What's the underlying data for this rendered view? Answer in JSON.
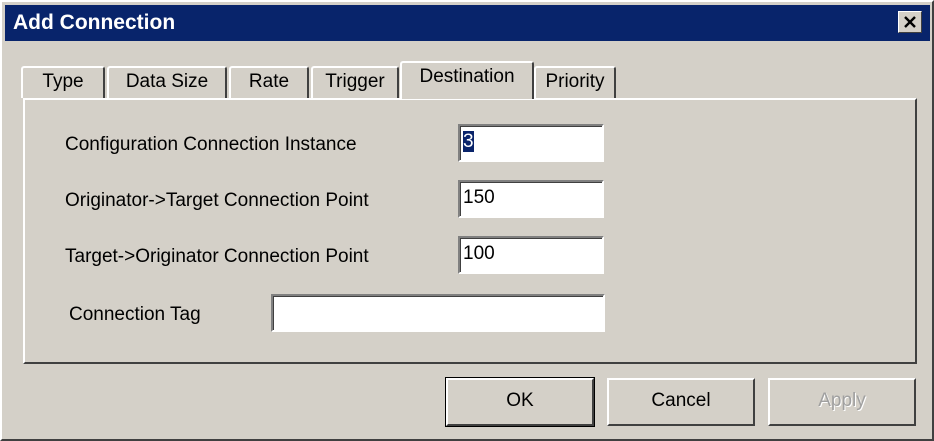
{
  "window": {
    "title": "Add Connection"
  },
  "tabs": [
    {
      "label": "Type",
      "active": false
    },
    {
      "label": "Data Size",
      "active": false
    },
    {
      "label": "Rate",
      "active": false
    },
    {
      "label": "Trigger",
      "active": false
    },
    {
      "label": "Destination",
      "active": true
    },
    {
      "label": "Priority",
      "active": false
    }
  ],
  "destination": {
    "config_instance": {
      "label": "Configuration Connection Instance",
      "value": "3"
    },
    "o_to_t_point": {
      "label": "Originator->Target Connection Point",
      "value": "150"
    },
    "t_to_o_point": {
      "label": "Target->Originator Connection Point",
      "value": "100"
    },
    "connection_tag": {
      "label": "Connection Tag",
      "value": ""
    }
  },
  "buttons": {
    "ok": "OK",
    "cancel": "Cancel",
    "apply": "Apply"
  },
  "colors": {
    "titlebar": "#08246b",
    "face": "#d4d0c8",
    "selection": "#0a246a"
  },
  "icons": {
    "close": "close-icon"
  }
}
